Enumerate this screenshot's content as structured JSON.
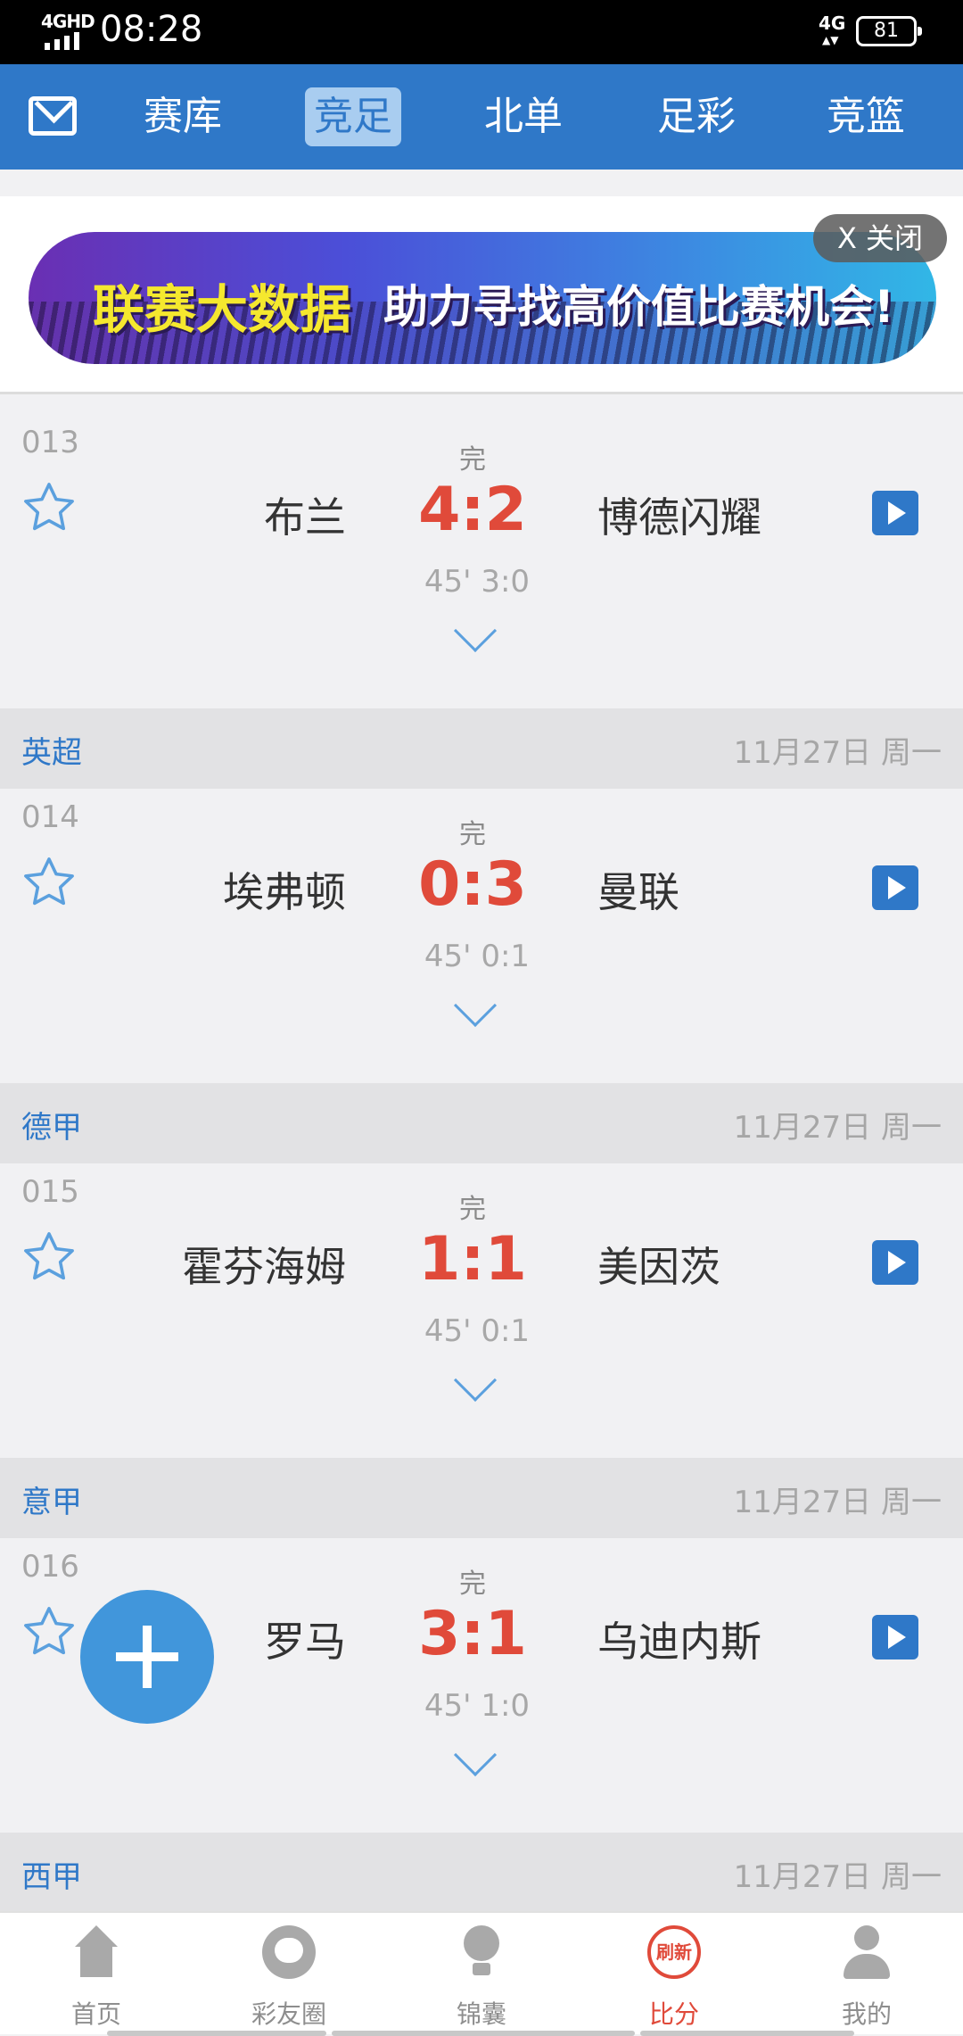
{
  "status_bar": {
    "network": "4GHD",
    "time": "08:28",
    "network2": "4G",
    "battery": "81"
  },
  "topnav": {
    "tabs": [
      "赛库",
      "竞足",
      "北单",
      "足彩",
      "竞篮"
    ],
    "active": "竞足"
  },
  "banner": {
    "text1": "联赛大数据",
    "text2": "助力寻找高价值比赛机会!",
    "close_label": "X 关闭"
  },
  "matches": [
    {
      "no": "013",
      "status": "完",
      "home": "布兰",
      "score": "4:2",
      "away": "博德闪耀",
      "half": "45' 3:0"
    },
    {
      "no": "014",
      "status": "完",
      "home": "埃弗顿",
      "score": "0:3",
      "away": "曼联",
      "half": "45' 0:1"
    },
    {
      "no": "015",
      "status": "完",
      "home": "霍芬海姆",
      "score": "1:1",
      "away": "美因茨",
      "half": "45' 0:1"
    },
    {
      "no": "016",
      "status": "完",
      "home": "罗马",
      "score": "3:1",
      "away": "乌迪内斯",
      "half": "45' 1:0"
    }
  ],
  "leagues": [
    {
      "name": "英超",
      "date": "11月27日 周一"
    },
    {
      "name": "德甲",
      "date": "11月27日 周一"
    },
    {
      "name": "意甲",
      "date": "11月27日 周一"
    },
    {
      "name": "西甲",
      "date": "11月27日 周一"
    }
  ],
  "bottom_nav": {
    "items": [
      "首页",
      "彩友圈",
      "锦囊",
      "比分",
      "我的"
    ],
    "refresh_label": "刷新",
    "active": "比分"
  },
  "colors": {
    "primary": "#2f78c8",
    "score": "#e04a3a",
    "fab": "#4196db"
  }
}
